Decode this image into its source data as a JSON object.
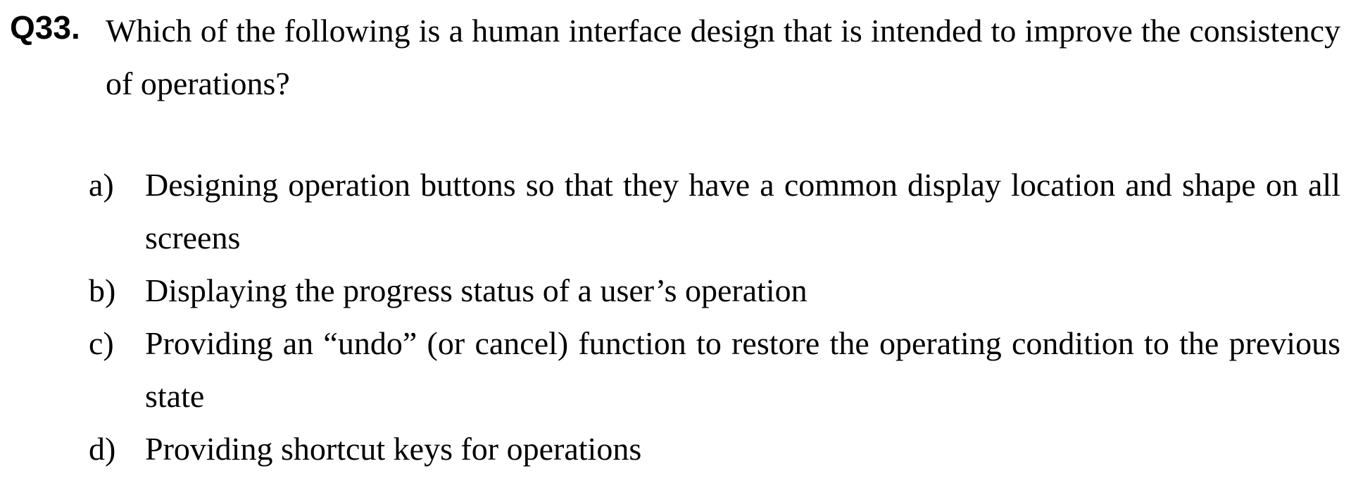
{
  "question": {
    "number": "Q33.",
    "text": "Which of the following is a human interface design that is intended to improve the consistency of operations?"
  },
  "options": [
    {
      "marker": "a)",
      "text": "Designing operation buttons so that they have a common display location and shape on all screens"
    },
    {
      "marker": "b)",
      "text": "Displaying the progress status of a user’s operation"
    },
    {
      "marker": "c)",
      "text": "Providing an “undo” (or cancel) function to restore the operating condition to the previous state"
    },
    {
      "marker": "d)",
      "text": "Providing shortcut keys for operations"
    }
  ]
}
